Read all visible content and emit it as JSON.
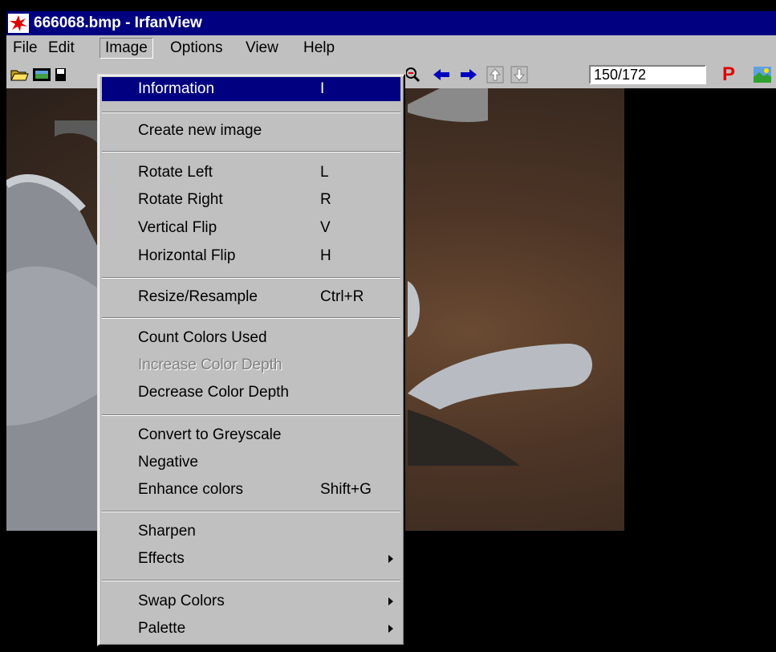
{
  "window": {
    "title": "666068.bmp - IrfanView"
  },
  "menubar": {
    "items": [
      "File",
      "Edit",
      "Image",
      "Options",
      "View",
      "Help"
    ],
    "open_menu": "Image"
  },
  "toolbar": {
    "counter": "150/172",
    "p_label": "P"
  },
  "colors": {
    "titlebar": "#000080",
    "highlight": "#000080",
    "face": "#c0c0c0",
    "arrow_blue": "#0000c0",
    "p_red": "#e00000"
  },
  "image_menu": {
    "information": {
      "label": "Information",
      "shortcut": "I"
    },
    "create_new": {
      "label": "Create new image"
    },
    "rotate_left": {
      "label": "Rotate Left",
      "shortcut": "L"
    },
    "rotate_right": {
      "label": "Rotate Right",
      "shortcut": "R"
    },
    "vertical_flip": {
      "label": "Vertical Flip",
      "shortcut": "V"
    },
    "horizontal_flip": {
      "label": "Horizontal Flip",
      "shortcut": "H"
    },
    "resize": {
      "label": "Resize/Resample",
      "shortcut": "Ctrl+R"
    },
    "count_colors": {
      "label": "Count Colors Used"
    },
    "increase_depth": {
      "label": "Increase Color Depth",
      "disabled": true
    },
    "decrease_depth": {
      "label": "Decrease Color Depth"
    },
    "greyscale": {
      "label": "Convert to Greyscale"
    },
    "negative": {
      "label": "Negative"
    },
    "enhance": {
      "label": "Enhance colors",
      "shortcut": "Shift+G"
    },
    "sharpen": {
      "label": "Sharpen"
    },
    "effects": {
      "label": "Effects"
    },
    "swap_colors": {
      "label": "Swap Colors"
    },
    "palette": {
      "label": "Palette"
    }
  }
}
